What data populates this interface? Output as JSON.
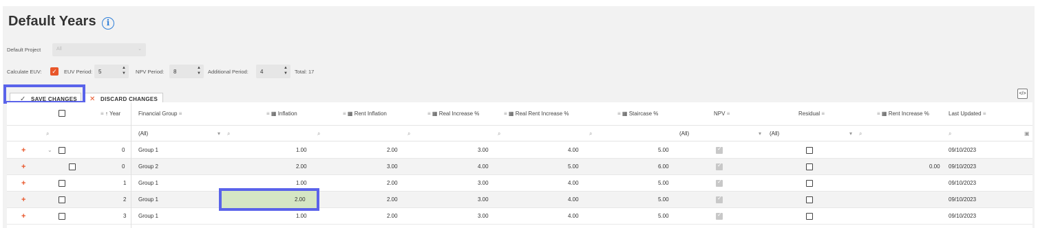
{
  "page": {
    "title": "Default Years",
    "info_icon": "info-icon"
  },
  "settings": {
    "default_project_label": "Default Project",
    "default_project_value": "All",
    "calculate_euv_label": "Calculate EUV:",
    "calculate_euv_checked": true,
    "euv_period_label": "EUV Period:",
    "euv_period_value": "5",
    "npv_period_label": "NPV Period:",
    "npv_period_value": "8",
    "additional_period_label": "Additional Period:",
    "additional_period_value": "4",
    "total_label": "Total: 17"
  },
  "toolbar": {
    "save_label": "SAVE CHANGES",
    "discard_label": "DISCARD CHANGES",
    "export_icon": "code-view-icon"
  },
  "grid": {
    "columns": {
      "year": "Year",
      "financial_group": "Financial Group",
      "inflation": "Inflation",
      "rent_inflation": "Rent Inflation",
      "real_increase": "Real Increase %",
      "real_rent_increase": "Real Rent Increase %",
      "staircase": "Staircase %",
      "npv": "NPV",
      "residual": "Residual",
      "rent_increase": "Rent Increase %",
      "last_updated": "Last Updated"
    },
    "filters": {
      "financial_group": "(All)",
      "npv": "(All)",
      "residual": "(All)"
    },
    "rows": [
      {
        "year": "0",
        "group": "Group 1",
        "inflation": "1.00",
        "rent_inflation": "2.00",
        "real_increase": "3.00",
        "real_rent_increase": "4.00",
        "staircase": "5.00",
        "npv": true,
        "residual": false,
        "rent_increase": "",
        "last_updated": "09/10/2023"
      },
      {
        "year": "0",
        "group": "Group 2",
        "inflation": "2.00",
        "rent_inflation": "3.00",
        "real_increase": "4.00",
        "real_rent_increase": "5.00",
        "staircase": "6.00",
        "npv": true,
        "residual": false,
        "rent_increase": "0.00",
        "last_updated": "09/10/2023"
      },
      {
        "year": "1",
        "group": "Group 1",
        "inflation": "1.00",
        "rent_inflation": "2.00",
        "real_increase": "3.00",
        "real_rent_increase": "4.00",
        "staircase": "5.00",
        "npv": true,
        "residual": false,
        "rent_increase": "",
        "last_updated": "09/10/2023"
      },
      {
        "year": "2",
        "group": "Group 1",
        "inflation": "2.00",
        "rent_inflation": "2.00",
        "real_increase": "3.00",
        "real_rent_increase": "4.00",
        "staircase": "5.00",
        "npv": true,
        "residual": false,
        "rent_increase": "",
        "last_updated": "09/10/2023"
      },
      {
        "year": "3",
        "group": "Group 1",
        "inflation": "1.00",
        "rent_inflation": "2.00",
        "real_increase": "3.00",
        "real_rent_increase": "4.00",
        "staircase": "5.00",
        "npv": true,
        "residual": false,
        "rent_increase": "",
        "last_updated": "09/10/2023"
      }
    ]
  },
  "colors": {
    "accent_orange": "#e8562a",
    "highlight_blue": "#5a63ea",
    "edited_cell": "#d5e6c4"
  }
}
